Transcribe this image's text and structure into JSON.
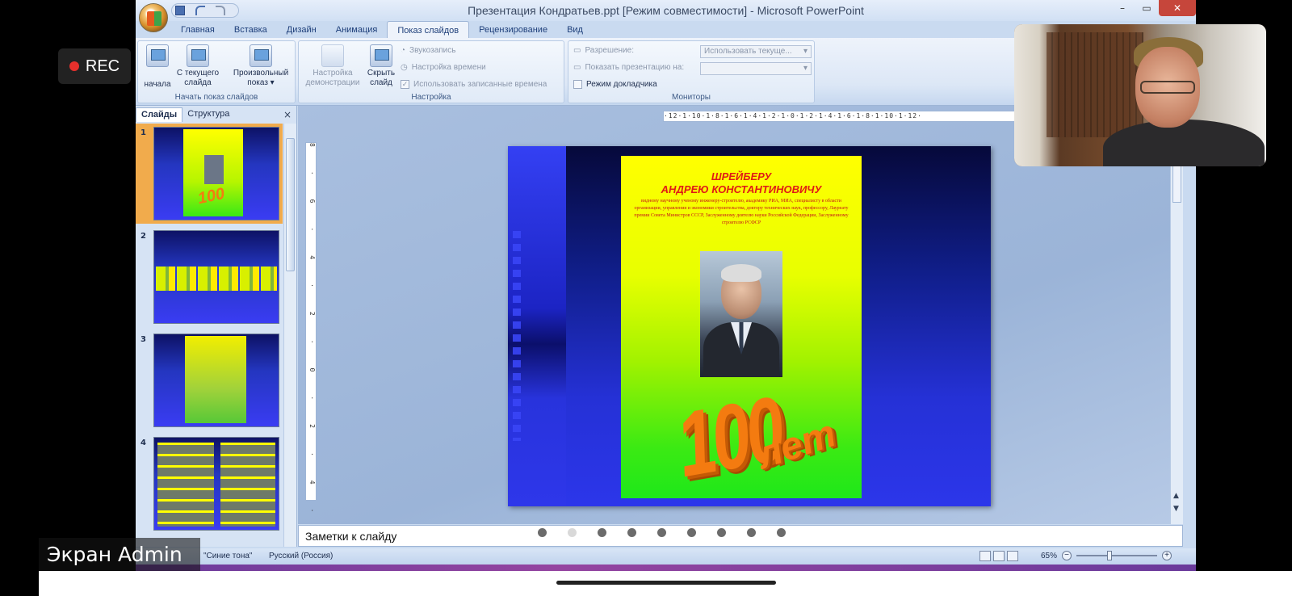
{
  "window": {
    "title": "Презентация Кондратьев.ppt [Режим совместимости] - Microsoft PowerPoint",
    "controls": [
      "–",
      "▭",
      "✕"
    ]
  },
  "tabs": [
    "Главная",
    "Вставка",
    "Дизайн",
    "Анимация",
    "Показ слайдов",
    "Рецензирование",
    "Вид"
  ],
  "active_tab": "Показ слайдов",
  "ribbon": {
    "group1": {
      "label": "Начать показ слайдов",
      "btn_start": "начала",
      "btn_current_l1": "С текущего",
      "btn_current_l2": "слайда",
      "btn_custom_l1": "Произвольный",
      "btn_custom_l2": "показ ▾"
    },
    "group2": {
      "label": "Настройка",
      "btn_setup_l1": "Настройка",
      "btn_setup_l2": "демонстрации",
      "btn_hide_l1": "Скрыть",
      "btn_hide_l2": "слайд",
      "record_sound": "Звукозапись",
      "rehearse": "Настройка времени",
      "use_timings": "Использовать записанные времена"
    },
    "group3": {
      "label": "Мониторы",
      "resolution_label": "Разрешение:",
      "resolution_value": "Использовать текуще...",
      "show_on_label": "Показать презентацию на:",
      "presenter_view": "Режим докладчика"
    }
  },
  "slides_pane": {
    "tab_slides": "Слайды",
    "tab_outline": "Структура",
    "close": "×",
    "numbers": [
      "1",
      "2",
      "3",
      "4"
    ]
  },
  "ruler": {
    "horizontal": "·12·1·10·1·8·1·6·1·4·1·2·1·0·1·2·1·4·1·6·1·8·1·10·1·12·",
    "vertical": "8·6·4·2·0·2·4·6·8"
  },
  "slide": {
    "title_line1": "ШРЕЙБЕРУ",
    "title_line2": "АНДРЕЮ КОНСТАНТИНОВИЧУ",
    "subtitle": "видному научному ученому инженеру-строителю, академику РИА, МИА, специалисту в области организации, управления и экономики строительства, доктору технических наук, профессору, Лауреату премии Совета Министров СССР, Заслуженному деятелю науки Российской Федерации, Заслуженному строителю РСФСР",
    "big_number": "100",
    "big_word": "лет"
  },
  "notes_placeholder": "Заметки к слайду",
  "status": {
    "theme": "\"Синие тона\"",
    "language": "Русский (Россия)",
    "zoom": "65%"
  },
  "overlay": {
    "rec_label": "REC",
    "caption": "Экран Admin",
    "page_dots": 9,
    "active_dot": 2
  },
  "colors": {
    "ribbon_bg": "#dce7f6",
    "slide_bg": "#2c36ea",
    "poster_top": "#ffff00",
    "poster_bottom": "#1ee81a",
    "title_red": "#e01a16",
    "number_orange": "#f47b10",
    "rec_dot": "#e5302c"
  },
  "icons": [
    "office-button",
    "save-icon",
    "undo-icon",
    "redo-icon",
    "slideshow-icon",
    "monitor-icon",
    "close-icon"
  ]
}
